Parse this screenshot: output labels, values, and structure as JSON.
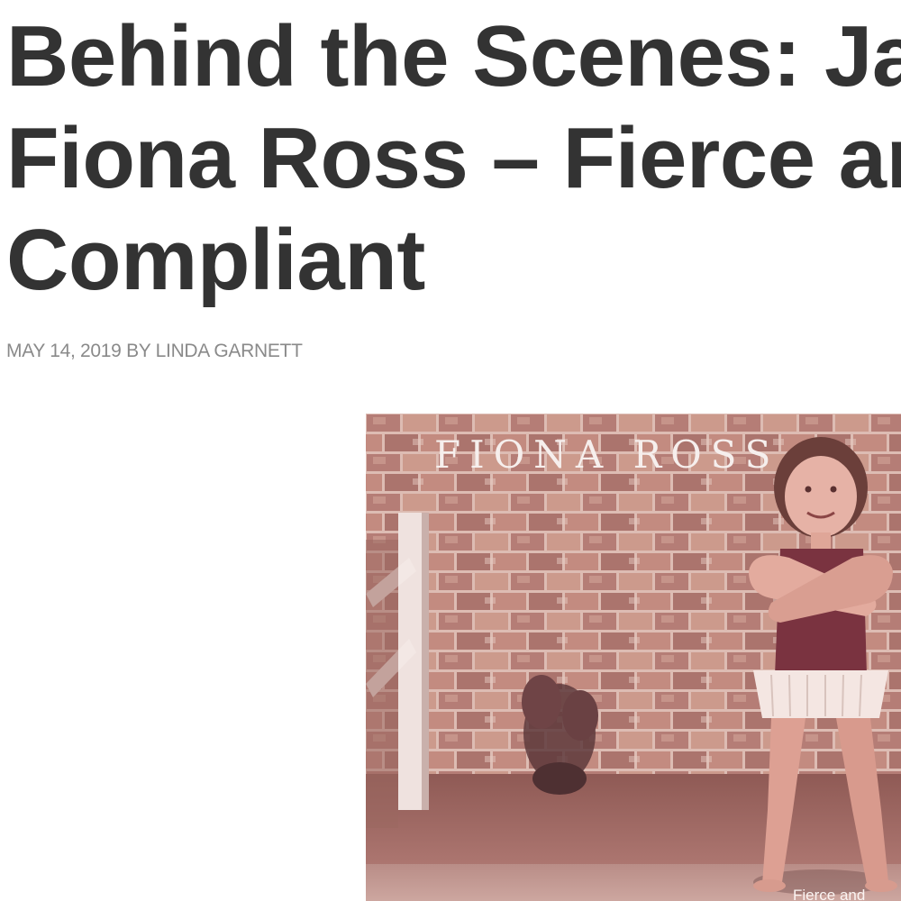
{
  "article": {
    "title_lines": [
      "Behind the Scenes: Ja",
      "Fiona Ross – Fierce ar",
      "Compliant"
    ],
    "byline": "MAY 14, 2019 BY LINDA GARNETT"
  },
  "album_cover": {
    "artist": "FIONA ROSS",
    "caption": "Fierce and"
  }
}
